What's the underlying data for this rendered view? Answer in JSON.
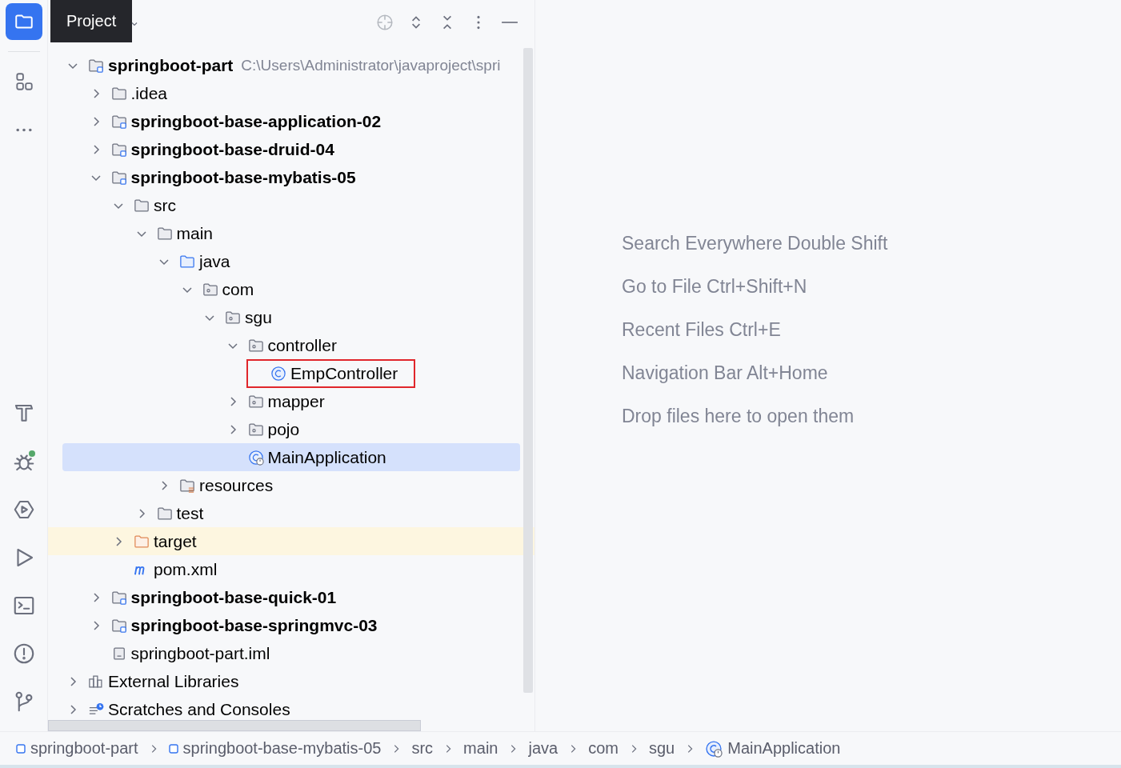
{
  "tool_strip": {
    "top": [
      {
        "kind": "project",
        "selected": true
      },
      {
        "kind": "structure",
        "selected": false
      },
      {
        "kind": "more",
        "selected": false
      }
    ],
    "bottom": [
      {
        "kind": "build",
        "selected": false,
        "indicator": false
      },
      {
        "kind": "debug",
        "selected": false,
        "indicator": true
      },
      {
        "kind": "services",
        "selected": false,
        "indicator": false
      },
      {
        "kind": "run",
        "selected": false,
        "indicator": false
      },
      {
        "kind": "terminal",
        "selected": false,
        "indicator": false
      },
      {
        "kind": "problems",
        "selected": false,
        "indicator": false
      },
      {
        "kind": "git",
        "selected": false,
        "indicator": false
      }
    ]
  },
  "panel": {
    "title": "Project",
    "tree": [
      {
        "label": "springboot-part",
        "kind": "module",
        "path": "C:\\Users\\Administrator\\javaproject\\spri",
        "expanded": true,
        "selected": false,
        "children": [
          {
            "label": ".idea",
            "kind": "folder",
            "expanded": false,
            "selected": false
          },
          {
            "label": "springboot-base-application-02",
            "kind": "module",
            "expanded": false,
            "selected": false
          },
          {
            "label": "springboot-base-druid-04",
            "kind": "module",
            "expanded": false,
            "selected": false
          },
          {
            "label": "springboot-base-mybatis-05",
            "kind": "module",
            "expanded": true,
            "selected": false,
            "children": [
              {
                "label": "src",
                "kind": "folder",
                "expanded": true,
                "selected": false,
                "children": [
                  {
                    "label": "main",
                    "kind": "folder",
                    "expanded": true,
                    "selected": false,
                    "children": [
                      {
                        "label": "java",
                        "kind": "source",
                        "expanded": true,
                        "selected": false,
                        "children": [
                          {
                            "label": "com",
                            "kind": "package",
                            "expanded": true,
                            "selected": false,
                            "children": [
                              {
                                "label": "sgu",
                                "kind": "package",
                                "expanded": true,
                                "selected": false,
                                "children": [
                                  {
                                    "label": "controller",
                                    "kind": "package",
                                    "expanded": true,
                                    "selected": false,
                                    "children": [
                                      {
                                        "label": "EmpController",
                                        "kind": "class",
                                        "selected": false,
                                        "outlined": true
                                      }
                                    ]
                                  },
                                  {
                                    "label": "mapper",
                                    "kind": "package",
                                    "expanded": false,
                                    "selected": false
                                  },
                                  {
                                    "label": "pojo",
                                    "kind": "package",
                                    "expanded": false,
                                    "selected": false
                                  },
                                  {
                                    "label": "MainApplication",
                                    "kind": "main-class",
                                    "selected": true
                                  }
                                ]
                              }
                            ]
                          }
                        ]
                      },
                      {
                        "label": "resources",
                        "kind": "resources",
                        "expanded": false,
                        "selected": false
                      }
                    ]
                  },
                  {
                    "label": "test",
                    "kind": "folder",
                    "expanded": false,
                    "selected": false
                  }
                ]
              },
              {
                "label": "target",
                "kind": "excluded",
                "expanded": false,
                "selected": false
              },
              {
                "label": "pom.xml",
                "kind": "maven",
                "selected": false
              }
            ]
          },
          {
            "label": "springboot-base-quick-01",
            "kind": "module",
            "expanded": false,
            "selected": false
          },
          {
            "label": "springboot-base-springmvc-03",
            "kind": "module",
            "expanded": false,
            "selected": false
          },
          {
            "label": "springboot-part.iml",
            "kind": "iml",
            "selected": false
          }
        ]
      },
      {
        "label": "External Libraries",
        "kind": "libraries",
        "expanded": false,
        "selected": false
      },
      {
        "label": "Scratches and Consoles",
        "kind": "scratches",
        "expanded": false,
        "selected": false
      }
    ]
  },
  "editor_hints": [
    "Search Everywhere Double Shift",
    "Go to File Ctrl+Shift+N",
    "Recent Files Ctrl+E",
    "Navigation Bar Alt+Home",
    "Drop files here to open them"
  ],
  "breadcrumbs": [
    {
      "label": "springboot-part",
      "kind": "module"
    },
    {
      "label": "springboot-base-mybatis-05",
      "kind": "module"
    },
    {
      "label": "src",
      "kind": "folder"
    },
    {
      "label": "main",
      "kind": "folder"
    },
    {
      "label": "java",
      "kind": "folder"
    },
    {
      "label": "com",
      "kind": "folder"
    },
    {
      "label": "sgu",
      "kind": "folder"
    },
    {
      "label": "MainApplication",
      "kind": "main-class"
    }
  ]
}
